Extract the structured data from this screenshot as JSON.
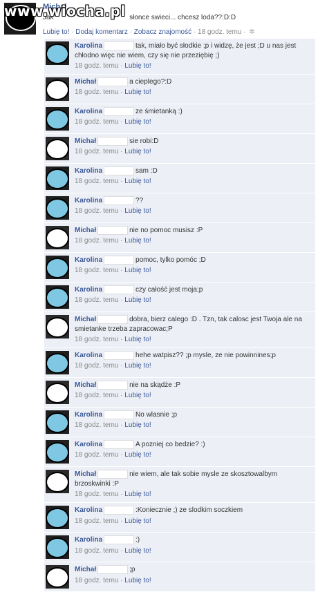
{
  "watermark": "www.wiocha.pl",
  "post": {
    "author": "Michał",
    "text_before": "Jak",
    "text_after": "słonce swieci... chcesz loda??:D:D",
    "like": "Lubię to!",
    "comment": "Dodaj komentarz",
    "friendship": "Zobacz znajomość",
    "time": "18 godz. temu"
  },
  "comments": [
    {
      "author": "Karolina",
      "text": "tak, miało być słodkie ;p i widzę, że jest ;D u nas jest chłodno więc nie wiem, czy się nie przeziębię ;)",
      "time": "18 godz. temu",
      "like": "Lubię to!",
      "avatar": "k"
    },
    {
      "author": "Michał",
      "text": "a cieplego?:D",
      "time": "18 godz. temu",
      "like": "Lubię to!",
      "avatar": "m"
    },
    {
      "author": "Karolina",
      "text": "ze śmietanką :)",
      "time": "18 godz. temu",
      "like": "Lubię to!",
      "avatar": "k"
    },
    {
      "author": "Michał",
      "text": "sie robi:D",
      "time": "18 godz. temu",
      "like": "Lubię to!",
      "avatar": "m"
    },
    {
      "author": "Karolina",
      "text": "sam :D",
      "time": "18 godz. temu",
      "like": "Lubię to!",
      "avatar": "k"
    },
    {
      "author": "Karolina",
      "text": "??",
      "time": "18 godz. temu",
      "like": "Lubię to!",
      "avatar": "k"
    },
    {
      "author": "Michał",
      "text": "nie no pomoc musisz :P",
      "time": "18 godz. temu",
      "like": "Lubię to!",
      "avatar": "m"
    },
    {
      "author": "Karolina",
      "text": "pomoc, tylko pomóc ;D",
      "time": "18 godz. temu",
      "like": "Lubię to!",
      "avatar": "k"
    },
    {
      "author": "Karolina",
      "text": "czy całość jest moja;p",
      "time": "18 godz. temu",
      "like": "Lubię to!",
      "avatar": "k"
    },
    {
      "author": "Michał",
      "text": "dobra, bierz calego :D . Tzn, tak calosc jest Twoja ale na smietanke trzeba zapracowac;P",
      "time": "18 godz. temu",
      "like": "Lubię to!",
      "avatar": "m"
    },
    {
      "author": "Karolina",
      "text": "hehe watpisz?? ;p mysle, ze nie powinnines;p",
      "time": "18 godz. temu",
      "like": "Lubię to!",
      "avatar": "k"
    },
    {
      "author": "Michał",
      "text": "nie na skądże :P",
      "time": "18 godz. temu",
      "like": "Lubię to!",
      "avatar": "m"
    },
    {
      "author": "Karolina",
      "text": "No wlasnie ;p",
      "time": "18 godz. temu",
      "like": "Lubię to!",
      "avatar": "k"
    },
    {
      "author": "Karolina",
      "text": "A pozniej co bedzie? :)",
      "time": "18 godz. temu",
      "like": "Lubię to!",
      "avatar": "k"
    },
    {
      "author": "Michał",
      "text": "nie wiem, ale tak sobie mysle ze skosztowalbym brzoskwinki :P",
      "time": "18 godz. temu",
      "like": "Lubię to!",
      "avatar": "m"
    },
    {
      "author": "Karolina",
      "text": ":Koniecznie ;) ze slodkim soczkiem",
      "time": "18 godz. temu",
      "like": "Lubię to!",
      "avatar": "k"
    },
    {
      "author": "Karolina",
      "text": ":)",
      "time": "18 godz. temu",
      "like": "Lubię to!",
      "avatar": "k"
    },
    {
      "author": "Michał",
      "text": ";p",
      "time": "18 godz. temu",
      "like": "Lubię to!",
      "avatar": "m"
    }
  ]
}
